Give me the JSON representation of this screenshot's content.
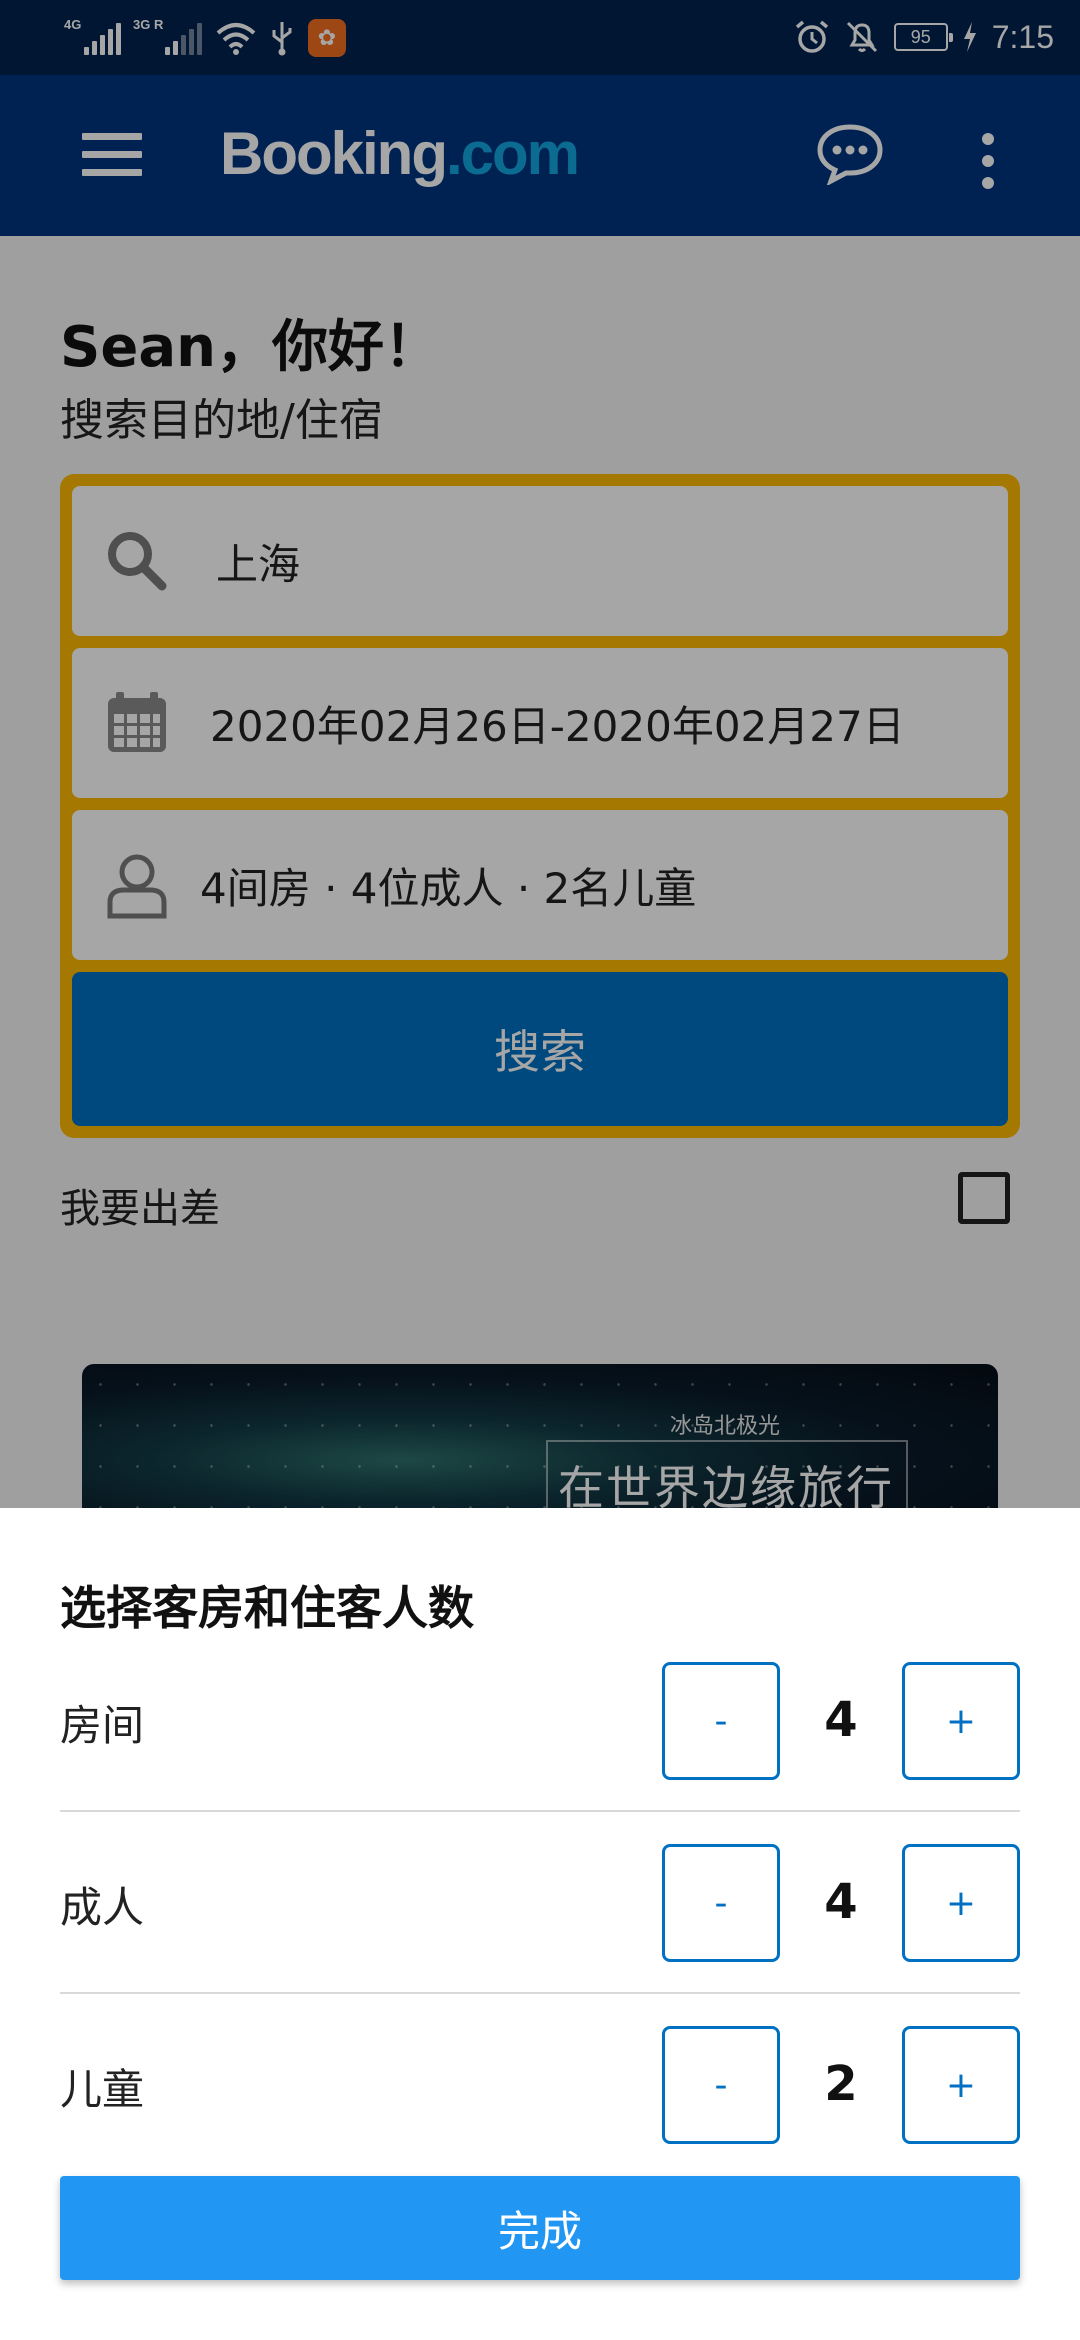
{
  "status_bar": {
    "network_1": "4G",
    "network_2": "3G R",
    "battery": "95",
    "time": "7:15",
    "icons": [
      "signal-icon",
      "wifi-icon",
      "usb-icon",
      "app-icon",
      "alarm-icon",
      "mute-icon",
      "battery-icon",
      "charging-icon"
    ]
  },
  "header": {
    "logo_brand": "Booking",
    "logo_tld": ".com",
    "icons": [
      "menu-icon",
      "chat-icon",
      "more-vertical-icon"
    ]
  },
  "main": {
    "greeting": "Sean，你好！",
    "subtitle": "搜索目的地/住宿",
    "search": {
      "destination": "上海",
      "dates": "2020年02月26日-2020年02月27日",
      "guests": "4间房 · 4位成人 · 2名儿童",
      "button": "搜索"
    },
    "business_trip_label": "我要出差",
    "promo": {
      "subtitle": "冰岛北极光",
      "title": "在世界边缘旅行"
    }
  },
  "sheet": {
    "title": "选择客房和住客人数",
    "rows": [
      {
        "label": "房间",
        "value": "4",
        "minus": "-",
        "plus": "+"
      },
      {
        "label": "成人",
        "value": "4",
        "minus": "-",
        "plus": "+"
      },
      {
        "label": "儿童",
        "value": "2",
        "minus": "-",
        "plus": "+"
      }
    ],
    "done_button": "完成"
  },
  "colors": {
    "status_bar": "#00224f",
    "header": "#003580",
    "search_border": "#febb02",
    "search_button": "#0071c2",
    "done_button": "#2196f3",
    "stepper": "#0071c2"
  }
}
